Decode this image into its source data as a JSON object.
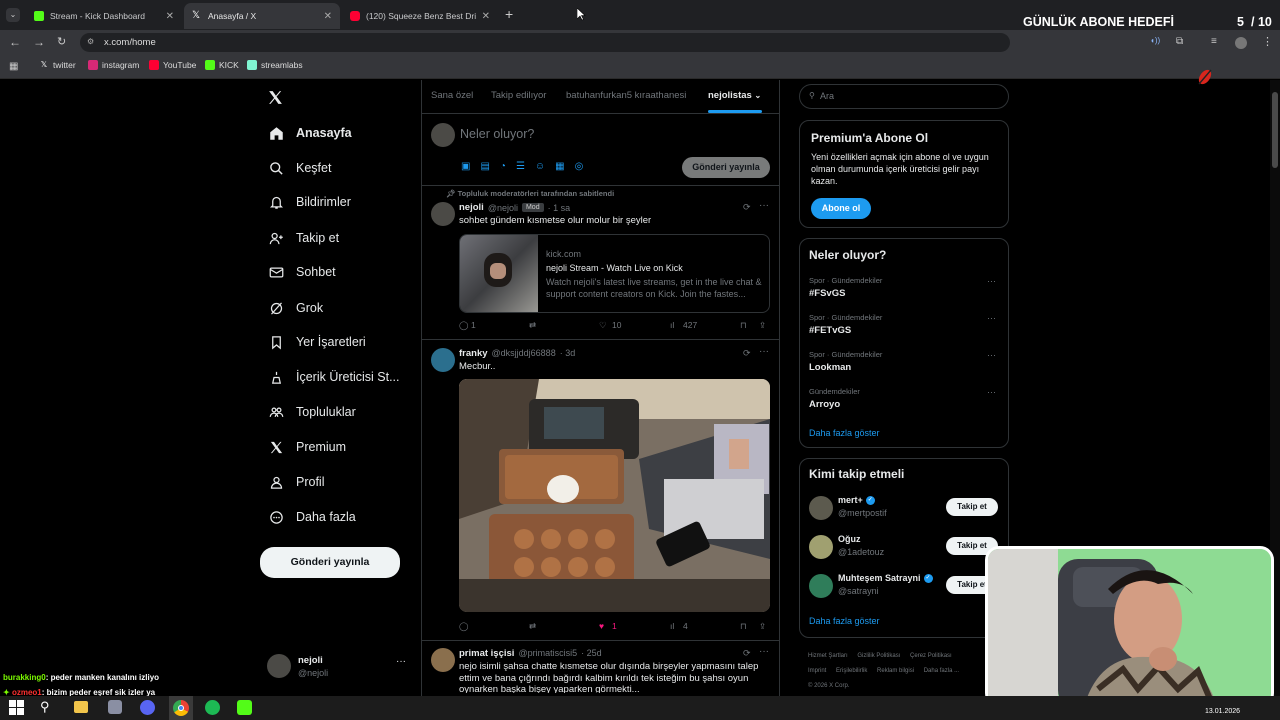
{
  "browser": {
    "tabs": [
      {
        "title": "Stream - Kick Dashboard",
        "color": "#53fc18"
      },
      {
        "title": "Anasayfa / X",
        "color": "#ffffff"
      },
      {
        "title": "(120) Squeeze Benz Best Driftin",
        "color": "#ff0033"
      }
    ],
    "url": "x.com/home",
    "bookmarks": [
      "twitter",
      "instagram",
      "YouTube",
      "KICK",
      "streamlabs"
    ]
  },
  "overlay": {
    "goal_title": "GÜNLÜK ABONE HEDEFİ",
    "goal_count": "5",
    "goal_total": "/ 10",
    "goal_progress": 0.5
  },
  "nav": {
    "items": [
      {
        "label": "Anasayfa",
        "icon": "home-icon"
      },
      {
        "label": "Keşfet",
        "icon": "search-icon"
      },
      {
        "label": "Bildirimler",
        "icon": "bell-icon"
      },
      {
        "label": "Takip et",
        "icon": "follow-icon"
      },
      {
        "label": "Sohbet",
        "icon": "mail-icon"
      },
      {
        "label": "Grok",
        "icon": "grok-icon"
      },
      {
        "label": "Yer İşaretleri",
        "icon": "bookmark-icon"
      },
      {
        "label": "İçerik Üreticisi St...",
        "icon": "creator-icon"
      },
      {
        "label": "Topluluklar",
        "icon": "communities-icon"
      },
      {
        "label": "Premium",
        "icon": "x-logo-icon"
      },
      {
        "label": "Profil",
        "icon": "profile-icon"
      },
      {
        "label": "Daha fazla",
        "icon": "more-icon"
      }
    ],
    "post_button": "Gönderi yayınla",
    "account_name": "nejoli",
    "account_handle": "@nejoli"
  },
  "feed": {
    "tabs": [
      "Sana özel",
      "Takip edilıyor",
      "batuhanfurkan5 kıraathanesi",
      "nejolistas"
    ],
    "compose_placeholder": "Neler oluyor?",
    "compose_button": "Gönderi yayınla",
    "tweets": [
      {
        "pinned": "Topluluk moderatörleri tarafından sabitlendi",
        "name": "nejoli",
        "handle": "@nejoli",
        "badge": "Mod",
        "time": "· 1 sa",
        "text": "sohbet gündem kısmetse olur molur bir şeyler",
        "card_domain": "kick.com",
        "card_title": "nejoli Stream - Watch Live on Kick",
        "card_desc": "Watch nejoli's latest live streams, get in the live chat & support content creators on Kick. Join the fastes...",
        "replies": "1",
        "likes": "10",
        "views": "427"
      },
      {
        "name": "franky",
        "handle": "@dksjjddj66888",
        "time": "· 3d",
        "text": "Mecbur..",
        "likes": "1",
        "views": "4"
      },
      {
        "name": "primat işçisi",
        "handle": "@primatiscisi5",
        "time": "· 25d",
        "text": "nejo isimli şahsa chatte kısmetse olur dışında birşeyler yapmasını talep ettim ve bana çığrındı bağırdı kalbim kırıldı tek isteğim bu şahsı oyun oynarken başka bişey yaparken görmekti..."
      }
    ]
  },
  "sidebar": {
    "search_placeholder": "Ara",
    "premium_title": "Premium'a Abone Ol",
    "premium_text": "Yeni özellikleri açmak için abone ol ve uygun olman durumunda içerik üreticisi gelir payı kazan.",
    "premium_button": "Abone ol",
    "trends_title": "Neler oluyor?",
    "trends": [
      {
        "category": "Spor · Gündemdekiler",
        "name": "#FSvGS"
      },
      {
        "category": "Spor · Gündemdekiler",
        "name": "#FETvGS"
      },
      {
        "category": "Spor · Gündemdekiler",
        "name": "Lookman"
      },
      {
        "category": "Gündemdekiler",
        "name": "Arroyo"
      }
    ],
    "show_more": "Daha fazla göster",
    "follow_title": "Kimi takip etmeli",
    "follow": [
      {
        "name": "mert+",
        "handle": "@mertpostif",
        "button": "Takip et"
      },
      {
        "name": "Oğuz",
        "handle": "@1adetouz",
        "button": "Takip et"
      },
      {
        "name": "Muhteşem Satrayni",
        "handle": "@satrayni",
        "button": "Takip et"
      }
    ],
    "footer": [
      "Hizmet Şartları",
      "Gizlilik Politikası",
      "Çerez Politikası",
      "Imprint",
      "Erişilebilirlik",
      "Reklam bilgisi",
      "Daha fazla ...",
      "© 2026 X Corp."
    ]
  },
  "chat": [
    {
      "user": "burakking0",
      "text": ": peder manken kanalını izliyo",
      "color": "#7cfc00"
    },
    {
      "user": "ozmeo1",
      "text": ": bizim peder eşref sik izler ya",
      "color": "#ff3030"
    }
  ],
  "taskbar": {
    "date": "13.01.2026"
  }
}
